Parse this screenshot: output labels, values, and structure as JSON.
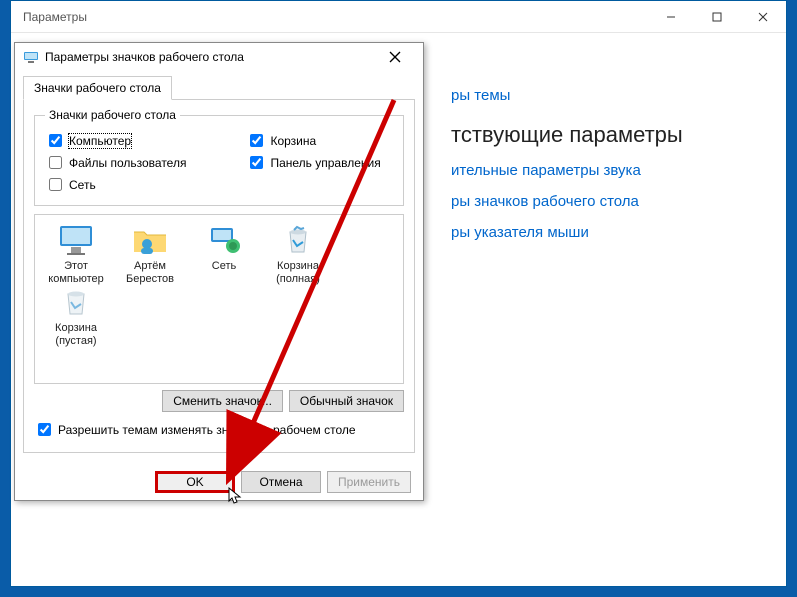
{
  "parent": {
    "title": "Параметры",
    "links": {
      "theme": "ры темы",
      "sound": "ительные параметры звука",
      "icons": "ры значков рабочего стола",
      "pointer": "ры указателя мыши"
    },
    "heading": "тствующие параметры"
  },
  "dialog": {
    "title": "Параметры значков рабочего стола",
    "tab": "Значки рабочего стола",
    "group_legend": "Значки рабочего стола",
    "checks": {
      "computer": "Компьютер",
      "userfiles": "Файлы пользователя",
      "network": "Сеть",
      "recycle": "Корзина",
      "control": "Панель управления"
    },
    "preview_icons": [
      {
        "key": "pc",
        "label": "Этот\nкомпьютер"
      },
      {
        "key": "user",
        "label": "Артём\nБерестов"
      },
      {
        "key": "net",
        "label": "Сеть"
      },
      {
        "key": "bin_full",
        "label": "Корзина\n(полная)"
      },
      {
        "key": "bin_empty",
        "label": "Корзина\n(пустая)"
      }
    ],
    "buttons": {
      "change": "Сменить значок...",
      "default": "Обычный значок",
      "allow_themes": "Разрешить темам изменять значки на рабочем столе",
      "ok": "OK",
      "cancel": "Отмена",
      "apply": "Применить"
    }
  }
}
